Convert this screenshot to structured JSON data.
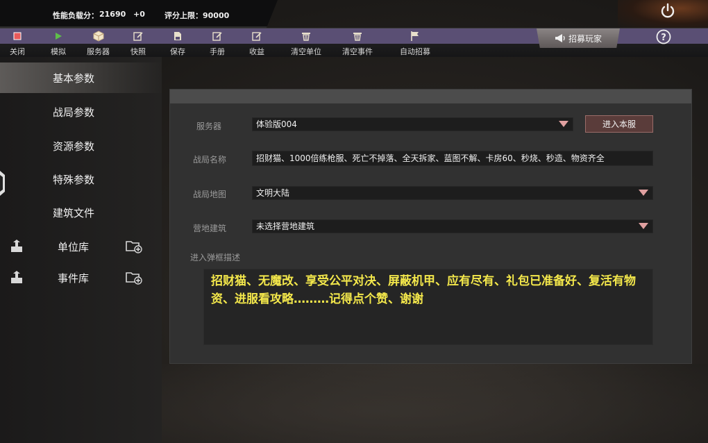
{
  "top_stats": {
    "perf_label": "性能负载分：",
    "perf_value": "21690",
    "perf_delta": "+0",
    "score_limit": "评分上限：90000"
  },
  "toolbar": {
    "items": [
      {
        "label": "关闭",
        "icon": "stop-icon"
      },
      {
        "label": "模拟",
        "icon": "play-icon"
      },
      {
        "label": "服务器",
        "icon": "cube-icon"
      },
      {
        "label": "快照",
        "icon": "edit-icon"
      },
      {
        "label": "保存",
        "icon": "save-icon"
      },
      {
        "label": "手册",
        "icon": "edit-icon"
      },
      {
        "label": "收益",
        "icon": "edit-icon"
      },
      {
        "label": "清空单位",
        "icon": "trash-icon"
      },
      {
        "label": "清空事件",
        "icon": "trash-icon"
      },
      {
        "label": "自动招募",
        "icon": "flag-icon"
      }
    ],
    "recruit_label": "招募玩家"
  },
  "sidebar": {
    "items": [
      {
        "label": "基本参数"
      },
      {
        "label": "战局参数"
      },
      {
        "label": "资源参数"
      },
      {
        "label": "特殊参数"
      },
      {
        "label": "建筑文件"
      }
    ],
    "libraries": [
      {
        "label": "单位库"
      },
      {
        "label": "事件库"
      }
    ]
  },
  "form": {
    "server_label": "服务器",
    "server_value": "体验版004",
    "enter_server_button": "进入本服",
    "match_name_label": "战局名称",
    "match_name_value": "招财猫、1000倍练枪服、死亡不掉落、全天拆家、蓝图不解、卡房60、秒烧、秒造、物资齐全",
    "map_label": "战局地图",
    "map_value": "文明大陆",
    "camp_label": "营地建筑",
    "camp_value": "未选择营地建筑",
    "popup_desc_label": "进入弹框描述",
    "popup_desc_value": "招财猫、无魔改、享受公平对决、屏蔽机甲、应有尽有、礼包已准备好、复活有物资、进服看攻略………记得点个赞、谢谢"
  },
  "colors": {
    "toolbar_strip": "#5a4f74",
    "description_text": "#f4e84b",
    "enter_button": "#5a3c3a",
    "stop_icon": "#e85a5a",
    "play_icon": "#5fbf4a"
  }
}
